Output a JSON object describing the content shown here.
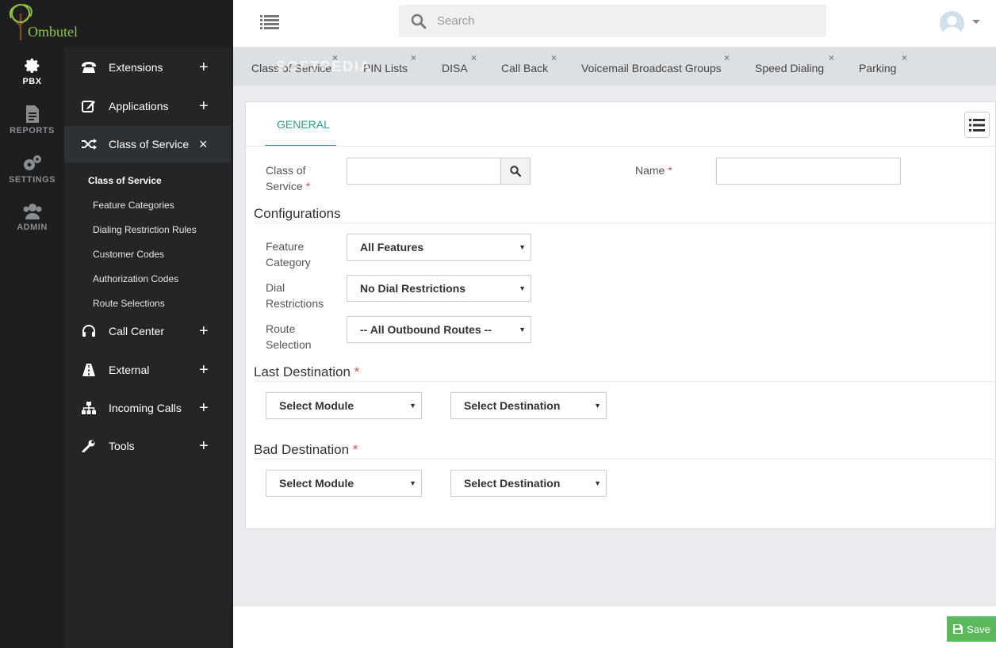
{
  "app": {
    "name": "Ombutel"
  },
  "rail": [
    {
      "label": "PBX",
      "icon": "gear-icon"
    },
    {
      "label": "REPORTS",
      "icon": "document-icon"
    },
    {
      "label": "SETTINGS",
      "icon": "gears-icon"
    },
    {
      "label": "ADMIN",
      "icon": "users-icon"
    }
  ],
  "nav": {
    "items": [
      {
        "label": "Extensions",
        "toggle": "+"
      },
      {
        "label": "Applications",
        "toggle": "+"
      },
      {
        "label": "Class of Service",
        "toggle": "×"
      },
      {
        "label": "Call Center",
        "toggle": "+"
      },
      {
        "label": "External",
        "toggle": "+"
      },
      {
        "label": "Incoming Calls",
        "toggle": "+"
      },
      {
        "label": "Tools",
        "toggle": "+"
      }
    ],
    "subitems": [
      "Class of Service",
      "Feature Categories",
      "Dialing Restriction Rules",
      "Customer Codes",
      "Authorization Codes",
      "Route Selections"
    ]
  },
  "search": {
    "placeholder": "Search"
  },
  "tabs": [
    "Class of Service",
    "PIN Lists",
    "DISA",
    "Call Back",
    "Voicemail Broadcast Groups",
    "Speed Dialing",
    "Parking"
  ],
  "tab_close": "×",
  "watermark": "SOFTPEDIA",
  "form": {
    "subtab": "GENERAL",
    "cos_label_1": "Class of",
    "cos_label_2": "Service",
    "name_label": "Name",
    "required_mark": "*",
    "configurations_title": "Configurations",
    "feature_label_1": "Feature",
    "feature_label_2": "Category",
    "feature_value": "All Features",
    "dial_label_1": "Dial",
    "dial_label_2": "Restrictions",
    "dial_value": "No Dial Restrictions",
    "route_label_1": "Route",
    "route_label_2": "Selection",
    "route_value": "-- All Outbound Routes --",
    "last_destination_title": "Last Destination",
    "bad_destination_title": "Bad Destination",
    "module_placeholder": "Select Module",
    "destination_placeholder": "Select Destination",
    "caret": "▼"
  },
  "footer": {
    "save_label": "Save"
  }
}
